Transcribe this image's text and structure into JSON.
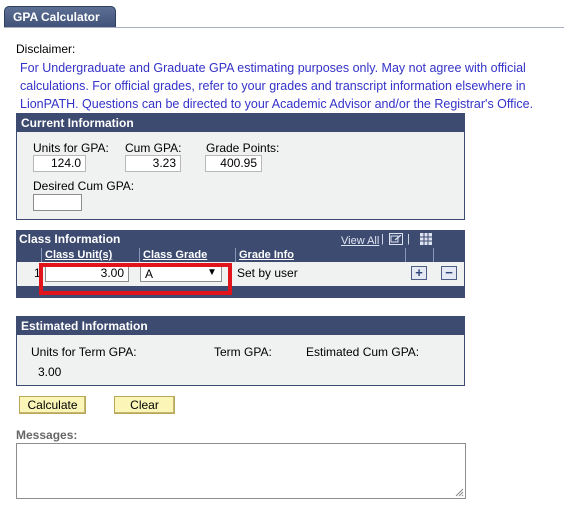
{
  "tab": {
    "label": "GPA Calculator"
  },
  "disclaimer": {
    "title": "Disclaimer:",
    "lines": [
      "For Undergraduate and Graduate GPA estimating purposes only. May not agree with official",
      "calculations. For official grades, refer to your grades and transcript information elsewhere in",
      "LionPATH. Questions can be directed to your Academic Advisor and/or the Registrar's Office."
    ]
  },
  "current": {
    "header": "Current Information",
    "units_label": "Units for GPA:",
    "units_value": "124.0",
    "cumgpa_label": "Cum GPA:",
    "cumgpa_value": "3.23",
    "gradepoints_label": "Grade Points:",
    "gradepoints_value": "400.95",
    "desired_label": "Desired Cum GPA:",
    "desired_value": ""
  },
  "classinfo": {
    "header": "Class Information",
    "view_all": "View All",
    "columns": [
      "Class Unit(s)",
      "Class Grade",
      "Grade Info"
    ],
    "row": {
      "num": "1",
      "units": "3.00",
      "grade": "A",
      "grade_info": "Set by user"
    },
    "add_symbol": "+",
    "remove_symbol": "−"
  },
  "estimated": {
    "header": "Estimated Information",
    "units_label": "Units for Term GPA:",
    "units_value": "3.00",
    "term_label": "Term GPA:",
    "term_value": "",
    "cum_label": "Estimated Cum GPA:",
    "cum_value": ""
  },
  "buttons": {
    "calculate": "Calculate",
    "clear": "Clear"
  },
  "messages": {
    "label": "Messages:",
    "value": ""
  },
  "colors": {
    "header_bg": "#3e4b71",
    "disclaimer_text": "#3432c8",
    "highlight": "#e2141b",
    "button_bg": "#fbf6b7"
  }
}
